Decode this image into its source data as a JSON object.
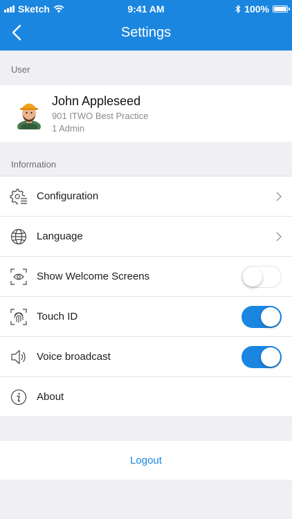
{
  "status_bar": {
    "carrier": "Sketch",
    "time": "9:41 AM",
    "battery": "100%"
  },
  "nav": {
    "title": "Settings",
    "back_icon": "chevron-left-icon"
  },
  "user_section": {
    "header": "User",
    "name": "John Appleseed",
    "line1": "901 ITWO Best  Practice",
    "line2": "1 Admin"
  },
  "info_section": {
    "header": "Information",
    "items": [
      {
        "label": "Configuration",
        "icon": "gear-list-icon",
        "accessory": "chevron"
      },
      {
        "label": "Language",
        "icon": "globe-icon",
        "accessory": "chevron"
      },
      {
        "label": "Show Welcome Screens",
        "icon": "eye-scan-icon",
        "accessory": "toggle",
        "on": false
      },
      {
        "label": "Touch ID",
        "icon": "fingerprint-icon",
        "accessory": "toggle",
        "on": true
      },
      {
        "label": "Voice broadcast",
        "icon": "speaker-icon",
        "accessory": "toggle",
        "on": true
      },
      {
        "label": "About",
        "icon": "info-icon",
        "accessory": "none"
      }
    ]
  },
  "logout": {
    "label": "Logout"
  },
  "colors": {
    "accent": "#1a86e0",
    "background": "#efeff4"
  }
}
